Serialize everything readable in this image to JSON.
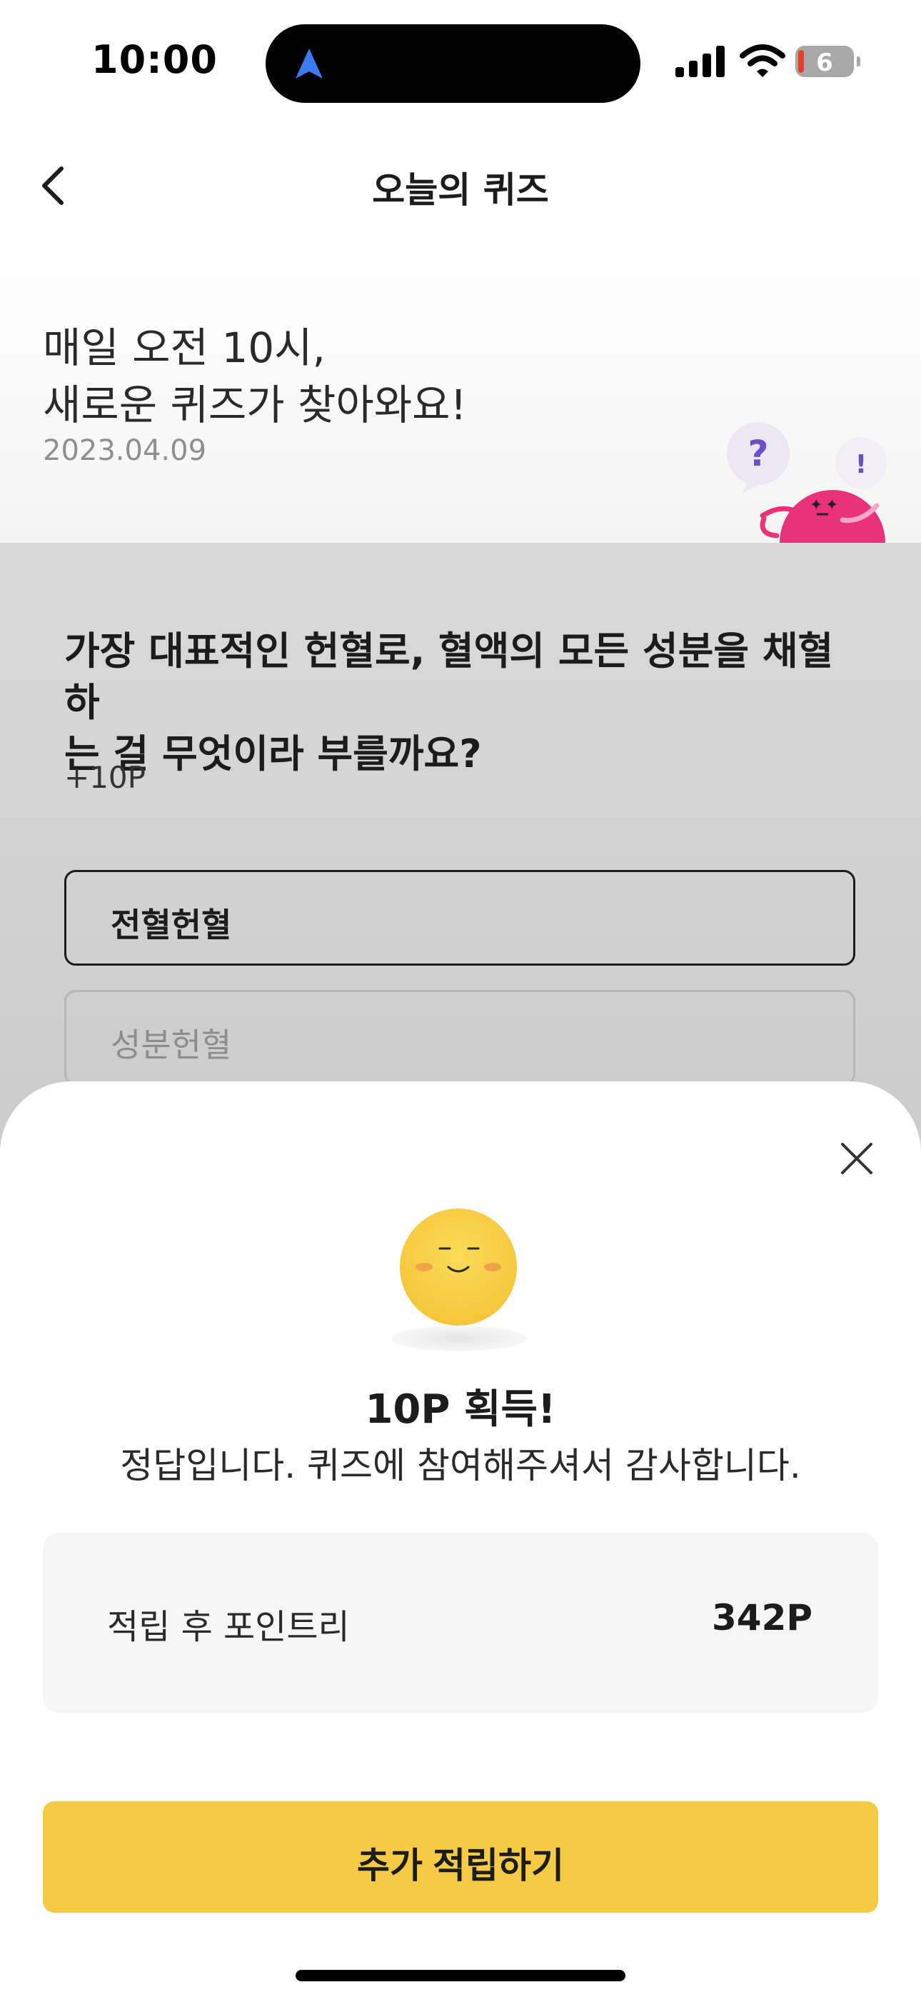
{
  "status_bar": {
    "time": "10:00",
    "battery_level": "6",
    "icons": [
      "navigation-arrow-icon",
      "cellular-signal-icon",
      "wifi-icon",
      "battery-icon"
    ]
  },
  "header": {
    "title": "오늘의 퀴즈",
    "back_icon": "chevron-left-icon"
  },
  "hero": {
    "line1": "매일 오전 10시,",
    "line2": "새로운 퀴즈가 찾아와요!",
    "date": "2023.04.09",
    "illustration": "mascot-question-illustration"
  },
  "quiz": {
    "question_line1": "가장 대표적인 헌혈로, 혈액의 모든 성분을 채혈하",
    "question_line2": "는 걸 무엇이라 부를까요?",
    "reward": "+10P",
    "options": [
      {
        "label": "전혈헌혈",
        "selected": true
      },
      {
        "label": "성분헌혈",
        "selected": false
      }
    ]
  },
  "result_sheet": {
    "close_icon": "close-icon",
    "emoji_icon": "smiley-face-icon",
    "title": "10P 획득!",
    "message": "정답입니다. 퀴즈에 참여해주셔서 감사합니다.",
    "points_label": "적립 후 포인트리",
    "points_value": "342P",
    "cta_label": "추가 적립하기"
  },
  "colors": {
    "accent_yellow": "#F5CB46",
    "mascot_pink": "#E8337A",
    "question_purple": "#6A4FC8",
    "overlay_gray": "#D4D4D4",
    "text_dark": "#1C1C1C"
  }
}
